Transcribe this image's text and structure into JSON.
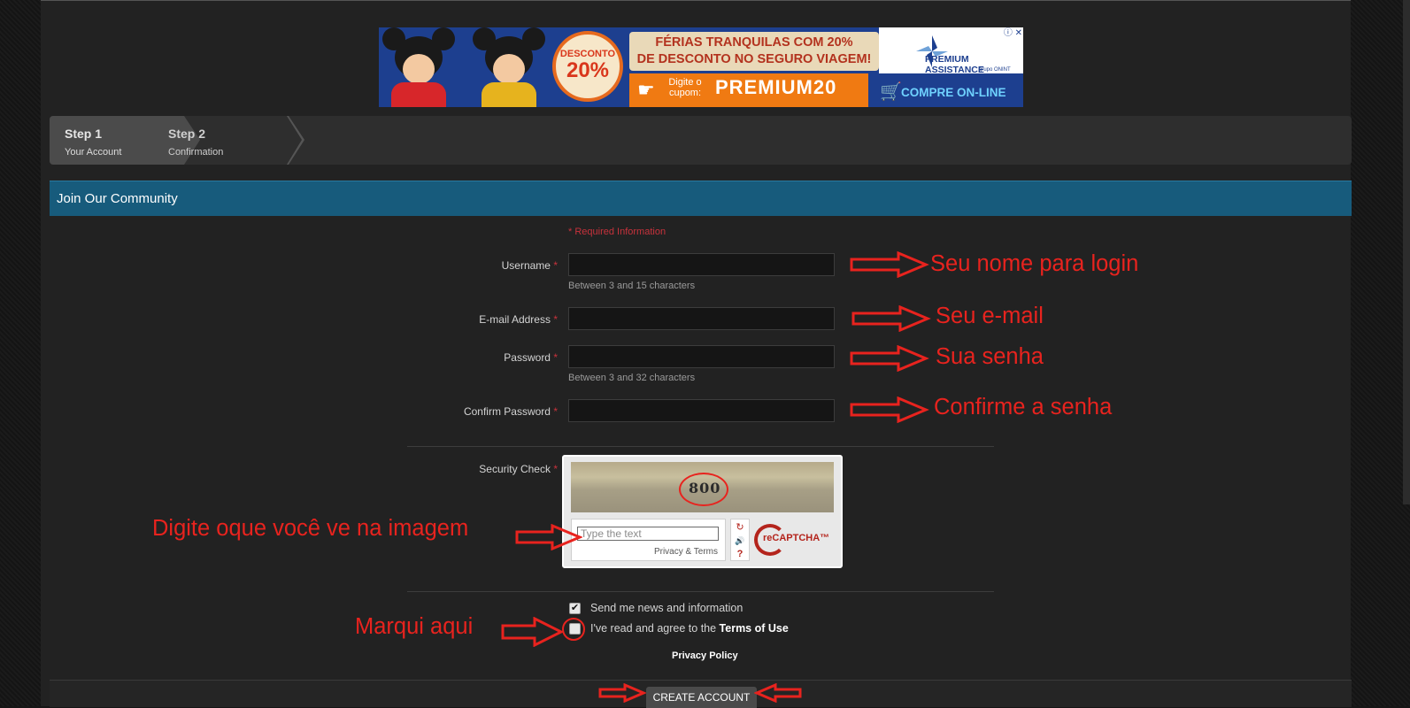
{
  "ad": {
    "discount_top": "DESCONTO",
    "discount_value": "20%",
    "headline_line1": "FÉRIAS TRANQUILAS COM 20%",
    "headline_line2": "DE DESCONTO NO SEGURO VIAGEM!",
    "coupon_label": "Digite o cupom:",
    "coupon_code": "PREMIUM20",
    "brand": "PREMIUM ASSISTANCE",
    "brand_sub": "grupo ONINT",
    "cta": "COMPRE ON-LINE",
    "close": "ⓘ ✕"
  },
  "steps": [
    {
      "title": "Step 1",
      "subtitle": "Your Account"
    },
    {
      "title": "Step 2",
      "subtitle": "Confirmation"
    }
  ],
  "header": {
    "title": "Join Our Community"
  },
  "form": {
    "required_note": "* Required Information",
    "star": "*",
    "username": {
      "label": "Username",
      "value": "",
      "hint": "Between 3 and 15 characters"
    },
    "email": {
      "label": "E-mail Address",
      "value": ""
    },
    "password": {
      "label": "Password",
      "value": "",
      "hint": "Between 3 and 32 characters"
    },
    "confirm": {
      "label": "Confirm Password",
      "value": ""
    },
    "security_label": "Security Check"
  },
  "captcha": {
    "word": "800",
    "placeholder": "Type the text",
    "privacy": "Privacy & Terms",
    "reload": "↻",
    "audio": "🔊",
    "help": "?",
    "brand": "reCAPTCHA™"
  },
  "checkboxes": {
    "news": {
      "label": "Send me news and information",
      "checked": true,
      "mark": "✔"
    },
    "terms": {
      "label_prefix": "I've read and agree to the ",
      "link": "Terms of Use",
      "checked": false,
      "mark": ""
    }
  },
  "privacy_policy": "Privacy Policy",
  "create_button": "CREATE ACCOUNT",
  "annotations": {
    "username": "Seu nome para login",
    "email": "Seu e-mail",
    "password": "Sua senha",
    "confirm": "Confirme a senha",
    "captcha": "Digite oque você ve na imagem",
    "terms": "Marqui aqui"
  },
  "colors": {
    "accent": "#175b7c",
    "annotation": "#e8231e",
    "required": "#c8323c"
  }
}
